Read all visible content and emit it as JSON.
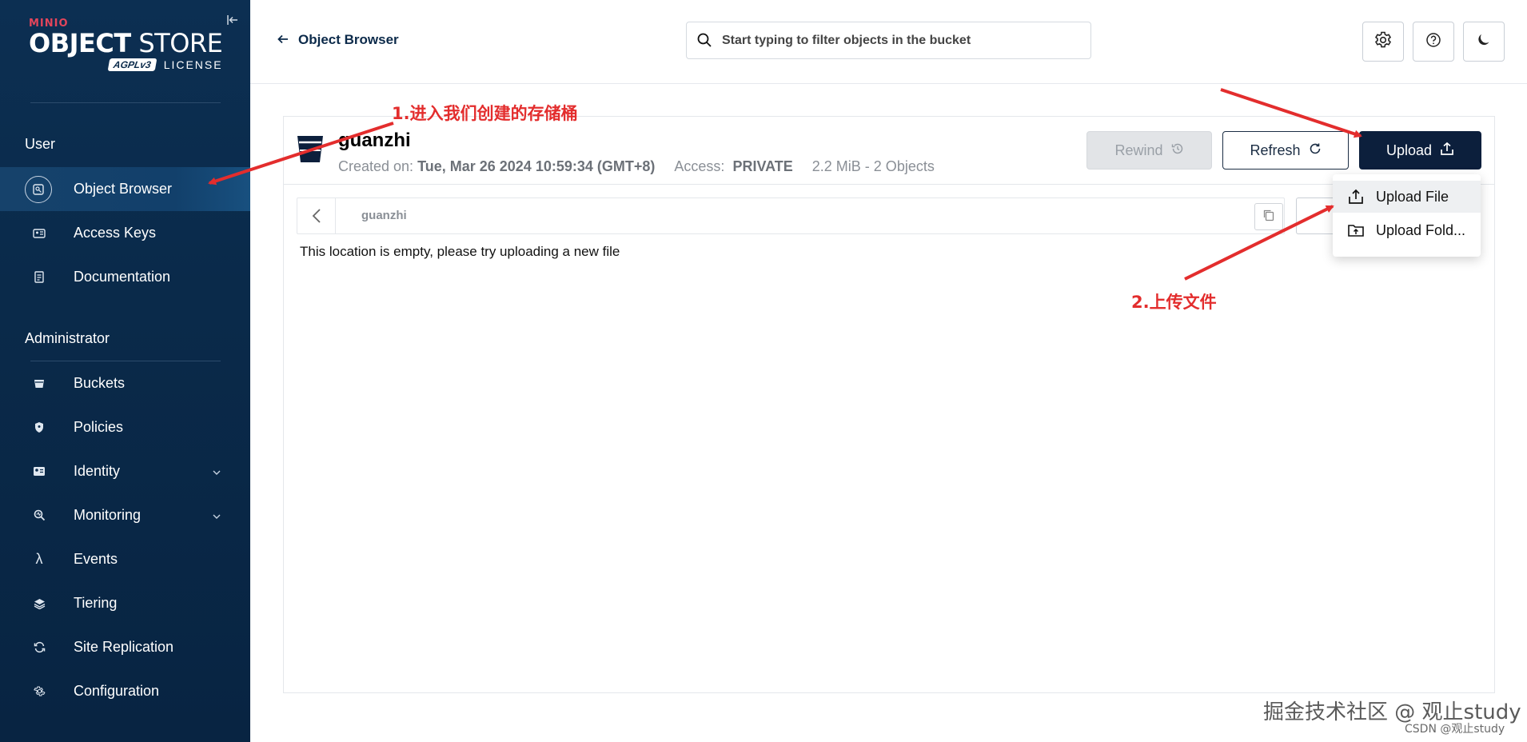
{
  "brand": {
    "minio": "MINIO",
    "object": "OBJECT",
    "store": "STORE",
    "agpl": "AGPLv3",
    "license": "LICENSE"
  },
  "sidebar": {
    "user_title": "User",
    "admin_title": "Administrator",
    "user_items": [
      {
        "label": "Object Browser",
        "icon": "object-browser-icon",
        "active": true
      },
      {
        "label": "Access Keys",
        "icon": "key-icon"
      },
      {
        "label": "Documentation",
        "icon": "document-icon"
      }
    ],
    "admin_items": [
      {
        "label": "Buckets",
        "icon": "bucket-icon"
      },
      {
        "label": "Policies",
        "icon": "shield-icon"
      },
      {
        "label": "Identity",
        "icon": "id-card-icon",
        "expandable": true
      },
      {
        "label": "Monitoring",
        "icon": "monitor-icon",
        "expandable": true
      },
      {
        "label": "Events",
        "icon": "lambda-icon"
      },
      {
        "label": "Tiering",
        "icon": "layers-icon"
      },
      {
        "label": "Site Replication",
        "icon": "replication-icon"
      },
      {
        "label": "Configuration",
        "icon": "gear-icon"
      }
    ]
  },
  "header": {
    "back_label": "Object Browser",
    "search_placeholder": "Start typing to filter objects in the bucket"
  },
  "bucket": {
    "name": "guanzhi",
    "created_label": "Created on:",
    "created_value": "Tue, Mar 26 2024 10:59:34 (GMT+8)",
    "access_label": "Access:",
    "access_value": "PRIVATE",
    "size": "2.2 MiB - 2 Objects",
    "rewind_label": "Rewind",
    "refresh_label": "Refresh",
    "upload_label": "Upload",
    "breadcrumb": "guanzhi",
    "empty_message": "This location is empty, please try uploading a new file"
  },
  "upload_menu": [
    {
      "label": "Upload File",
      "icon": "upload-file-icon"
    },
    {
      "label": "Upload Fold...",
      "icon": "upload-folder-icon"
    }
  ],
  "annotations": {
    "step1": "1.进入我们创建的存储桶",
    "step2": "2.上传文件",
    "color": "#e32d2d"
  },
  "watermark": {
    "main": "掘金技术社区 @ 观止study",
    "sub": "CSDN @观止study"
  }
}
